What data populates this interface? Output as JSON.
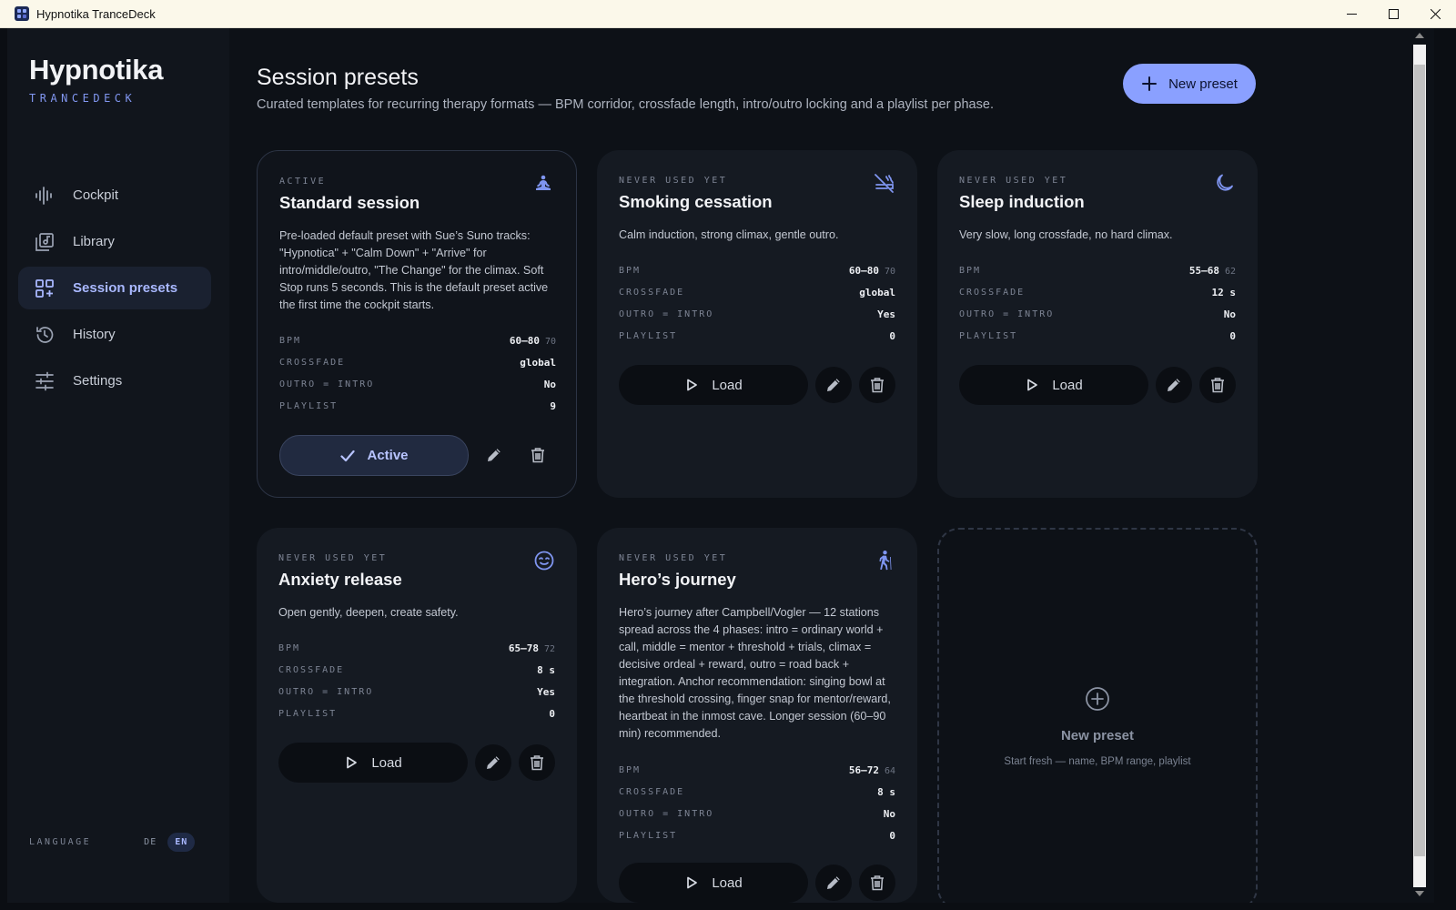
{
  "window": {
    "title": "Hypnotika TranceDeck"
  },
  "brand": {
    "name": "Hypnotika",
    "sub": "TRANCEDECK"
  },
  "nav": [
    {
      "label": "Cockpit",
      "icon": "waveform-icon",
      "active": false
    },
    {
      "label": "Library",
      "icon": "library-icon",
      "active": false
    },
    {
      "label": "Session presets",
      "icon": "grid-plus-icon",
      "active": true
    },
    {
      "label": "History",
      "icon": "history-icon",
      "active": false
    },
    {
      "label": "Settings",
      "icon": "sliders-icon",
      "active": false
    }
  ],
  "language": {
    "label": "LANGUAGE",
    "options": [
      "DE",
      "EN"
    ],
    "selected": "EN"
  },
  "page": {
    "title": "Session presets",
    "subtitle": "Curated templates for recurring therapy formats — BPM corridor, crossfade length, intro/outro locking and a playlist per phase.",
    "new_button": "New preset"
  },
  "labels": {
    "bpm": "BPM",
    "crossfade": "CROSSFADE",
    "outro": "OUTRO = INTRO",
    "playlist": "PLAYLIST",
    "load": "Load",
    "active": "Active"
  },
  "presets": [
    {
      "status": "ACTIVE",
      "name": "Standard session",
      "icon": "meditation-icon",
      "description": "Pre-loaded default preset with Sue’s Suno tracks: \"Hypnotica\" + \"Calm Down\" + \"Arrive\" for intro/middle/outro, \"The Change\" for the climax. Soft Stop runs 5 seconds. This is the default preset active the first time the cockpit starts.",
      "bpm": "60–80",
      "bpm_target": "70",
      "crossfade": "global",
      "outro": "No",
      "playlist": "9",
      "active": true
    },
    {
      "status": "NEVER USED YET",
      "name": "Smoking cessation",
      "icon": "no-smoking-icon",
      "description": "Calm induction, strong climax, gentle outro.",
      "bpm": "60–80",
      "bpm_target": "70",
      "crossfade": "global",
      "outro": "Yes",
      "playlist": "0",
      "active": false
    },
    {
      "status": "NEVER USED YET",
      "name": "Sleep induction",
      "icon": "moon-icon",
      "description": "Very slow, long crossfade, no hard climax.",
      "bpm": "55–68",
      "bpm_target": "62",
      "crossfade": "12 s",
      "outro": "No",
      "playlist": "0",
      "active": false
    },
    {
      "status": "NEVER USED YET",
      "name": "Anxiety release",
      "icon": "calm-face-icon",
      "description": "Open gently, deepen, create safety.",
      "bpm": "65–78",
      "bpm_target": "72",
      "crossfade": "8 s",
      "outro": "Yes",
      "playlist": "0",
      "active": false
    },
    {
      "status": "NEVER USED YET",
      "name": "Hero’s journey",
      "icon": "hiker-icon",
      "description": "Hero’s journey after Campbell/Vogler — 12 stations spread across the 4 phases: intro = ordinary world + call, middle = mentor + threshold + trials, climax = decisive ordeal + reward, outro = road back + integration. Anchor recommendation: singing bowl at the threshold crossing, finger snap for mentor/reward, heartbeat in the inmost cave. Longer session (60–90 min) recommended.",
      "bpm": "56–72",
      "bpm_target": "64",
      "crossfade": "8 s",
      "outro": "No",
      "playlist": "0",
      "active": false
    }
  ],
  "new_card": {
    "title": "New preset",
    "subtitle": "Start fresh — name, BPM range, playlist"
  },
  "colors": {
    "accent": "#8aa0ff",
    "background": "#0d1117",
    "card": "#151a22"
  }
}
